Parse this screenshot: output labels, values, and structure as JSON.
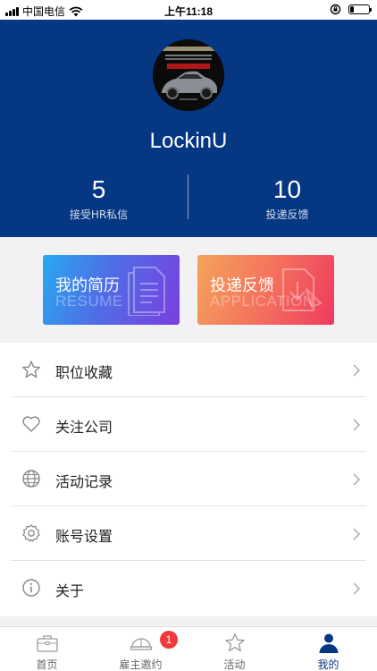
{
  "status_bar": {
    "carrier": "中国电信",
    "time": "上午11:18",
    "battery_level": 0.2
  },
  "profile": {
    "username": "LockinU",
    "stats": [
      {
        "value": "5",
        "label": "接受HR私信"
      },
      {
        "value": "10",
        "label": "投递反馈"
      }
    ]
  },
  "cards": {
    "resume": {
      "title": "我的简历",
      "subtitle": "RESUME"
    },
    "application": {
      "title": "投递反馈",
      "subtitle": "APPLICATION"
    }
  },
  "menu": {
    "items": [
      {
        "label": "职位收藏",
        "icon": "star-icon"
      },
      {
        "label": "关注公司",
        "icon": "heart-icon"
      },
      {
        "label": "活动记录",
        "icon": "globe-icon"
      },
      {
        "label": "账号设置",
        "icon": "gear-icon"
      },
      {
        "label": "关于",
        "icon": "info-icon"
      }
    ]
  },
  "tabbar": {
    "tabs": [
      {
        "label": "首页",
        "icon": "briefcase-icon"
      },
      {
        "label": "雇主邀约",
        "icon": "helmet-icon",
        "badge": "1"
      },
      {
        "label": "活动",
        "icon": "star-icon"
      },
      {
        "label": "我的",
        "icon": "user-icon",
        "active": true
      }
    ]
  },
  "colors": {
    "header_bg": "#063782",
    "badge": "#f23a3a",
    "resume_gradient": [
      "#28a9ef",
      "#7a3fdf"
    ],
    "application_gradient": [
      "#f4a35b",
      "#ee3a5f"
    ]
  }
}
